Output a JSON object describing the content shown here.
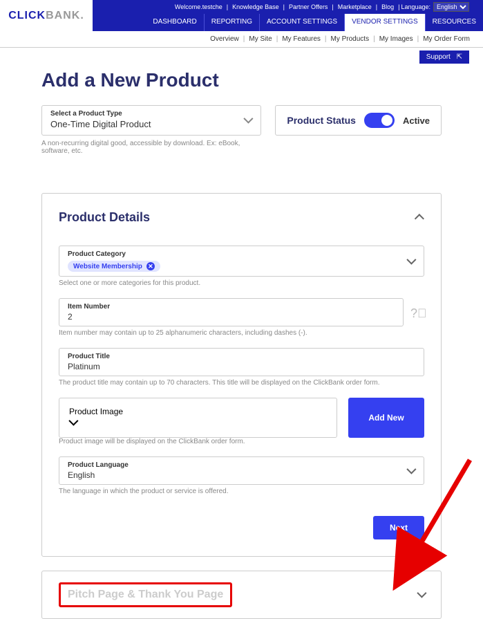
{
  "topbar": {
    "welcome": "Welcome.testche",
    "links": [
      "Knowledge Base",
      "Partner Offers",
      "Marketplace",
      "Blog"
    ],
    "language_label": "Language:",
    "language_value": "English"
  },
  "logo": {
    "click": "CLICK",
    "bank": "BANK."
  },
  "nav_tabs": [
    "DASHBOARD",
    "REPORTING",
    "ACCOUNT SETTINGS",
    "VENDOR SETTINGS",
    "RESOURCES"
  ],
  "nav_active_index": 3,
  "subnav": [
    "Overview",
    "My Site",
    "My Features",
    "My Products",
    "My Images",
    "My Order Form"
  ],
  "support_label": "Support",
  "page_title": "Add a New Product",
  "product_type": {
    "label": "Select a Product Type",
    "value": "One-Time Digital Product",
    "hint": "A non-recurring digital good, accessible by download. Ex: eBook, software, etc."
  },
  "status": {
    "label": "Product Status",
    "text": "Active"
  },
  "panel1": {
    "title": "Product Details",
    "category": {
      "label": "Product Category",
      "chip": "Website Membership",
      "hint": "Select one or more categories for this product."
    },
    "item_number": {
      "label": "Item Number",
      "value": "2",
      "hint": "Item number may contain up to 25 alphanumeric characters, including dashes (-)."
    },
    "product_title": {
      "label": "Product Title",
      "value": "Platinum",
      "hint": "The product title may contain up to 70 characters. This title will be displayed on the ClickBank order form."
    },
    "product_image": {
      "label": "Product Image",
      "add_new": "Add New",
      "hint": "Product image will be displayed on the ClickBank order form."
    },
    "product_language": {
      "label": "Product Language",
      "value": "English",
      "hint": "The language in which the product or service is offered."
    },
    "next": "Next"
  },
  "panel2": {
    "title": "Pitch Page & Thank You Page"
  }
}
